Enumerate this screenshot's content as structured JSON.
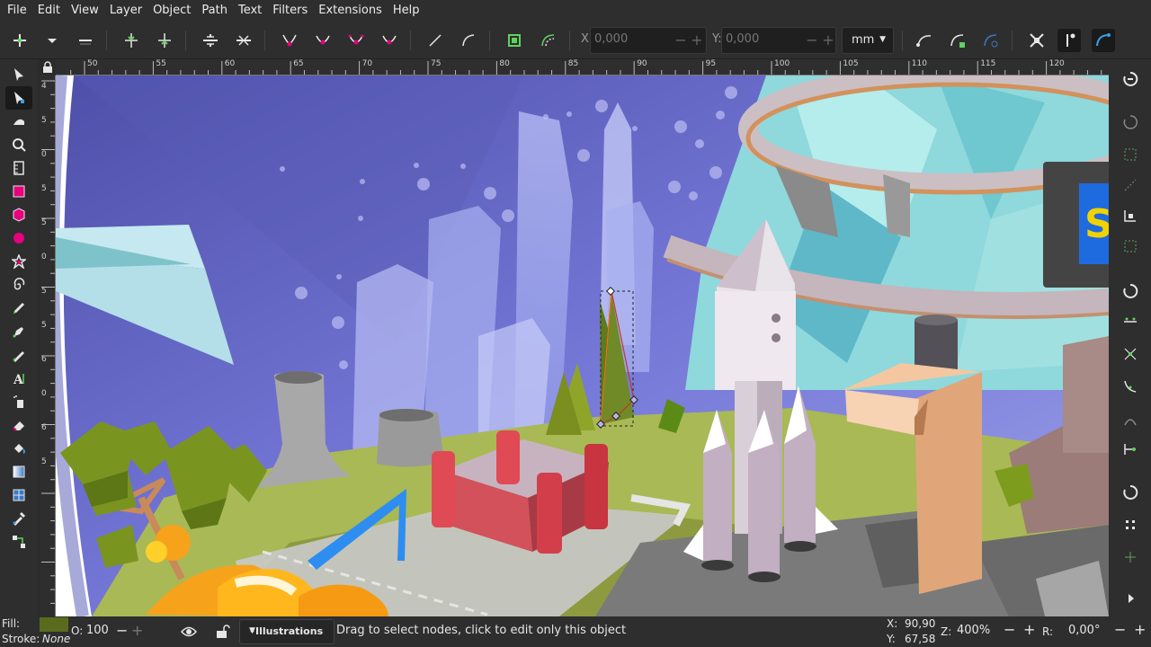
{
  "menu": [
    "File",
    "Edit",
    "View",
    "Layer",
    "Object",
    "Path",
    "Text",
    "Filters",
    "Extensions",
    "Help"
  ],
  "toolbar": {
    "x_label": "X:",
    "x_value": "0,000",
    "y_label": "Y:",
    "y_value": "0,000",
    "unit": "mm",
    "spin_minus": "−",
    "spin_plus": "+"
  },
  "ruler": {
    "h_numbers": [
      "50",
      "55",
      "60",
      "65",
      "70",
      "75",
      "80",
      "85",
      "90",
      "95",
      "100",
      "105",
      "110",
      "115",
      "120"
    ],
    "v_numbers": [
      "4",
      "5",
      "0",
      "5",
      "5",
      "0",
      "5",
      "5",
      "6",
      "0",
      "6",
      "5"
    ]
  },
  "status": {
    "fill_label": "Fill:",
    "stroke_label": "Stroke:",
    "stroke_value": "None",
    "opacity_label": "O:",
    "opacity_value": "100",
    "layer": "•Illustrations",
    "message": "Drag to select nodes, click to edit only this object",
    "x_label": "X:",
    "x_value": "90,90",
    "y_label": "Y:",
    "y_value": "67,58",
    "zoom_label": "Z:",
    "zoom_value": "400%",
    "rotation_label": "R:",
    "rotation_value": "0,00°",
    "minus": "−",
    "plus": "+"
  },
  "colors": {
    "fill_swatch": "#5b6b1e",
    "accent": "#3584e4",
    "sky": "#6f6fc8",
    "selection": "#c0392b"
  },
  "icons": {
    "tools": [
      "selector-icon",
      "node-tool-icon",
      "tweak-icon",
      "zoom-icon",
      "measure-icon",
      "rectangle-icon",
      "box3d-icon",
      "ellipse-icon",
      "star-icon",
      "spiral-icon",
      "pencil-icon",
      "pen-icon",
      "calligraphy-icon",
      "text-icon",
      "spray-icon",
      "eraser-icon",
      "bucket-icon",
      "gradient-icon",
      "mesh-icon",
      "dropper-icon",
      "connector-icon"
    ]
  }
}
